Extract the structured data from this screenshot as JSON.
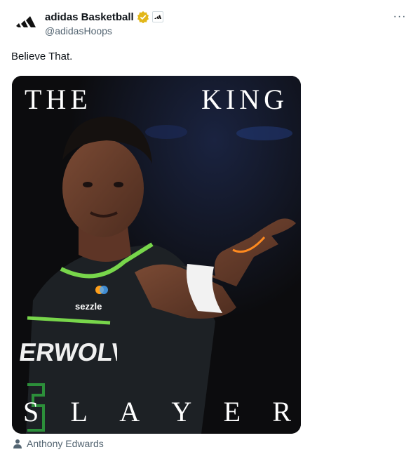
{
  "account": {
    "display_name": "adidas Basketball",
    "handle": "@adidasHoops",
    "avatar_icon": "adidas-logo-icon",
    "verified_icon": "verified-badge-icon",
    "verified_color": "#e2b719",
    "affiliate_icon": "adidas-affiliate-icon"
  },
  "menu": {
    "more_label": "···"
  },
  "tweet": {
    "text": "Believe That."
  },
  "media": {
    "top_left_word": "THE",
    "top_right_word": "KING",
    "bottom_letters": [
      "S",
      "L",
      "A",
      "Y",
      "E",
      "R"
    ],
    "jersey_text": "ERWOLVES",
    "sponsor_text": "sezzle",
    "jersey_number": "5"
  },
  "tag": {
    "icon": "person-icon",
    "label": "Anthony Edwards"
  },
  "colors": {
    "text_primary": "#0f1419",
    "text_secondary": "#536471",
    "media_background": "#0c0c0e",
    "jersey_trim": "#78d64b"
  }
}
